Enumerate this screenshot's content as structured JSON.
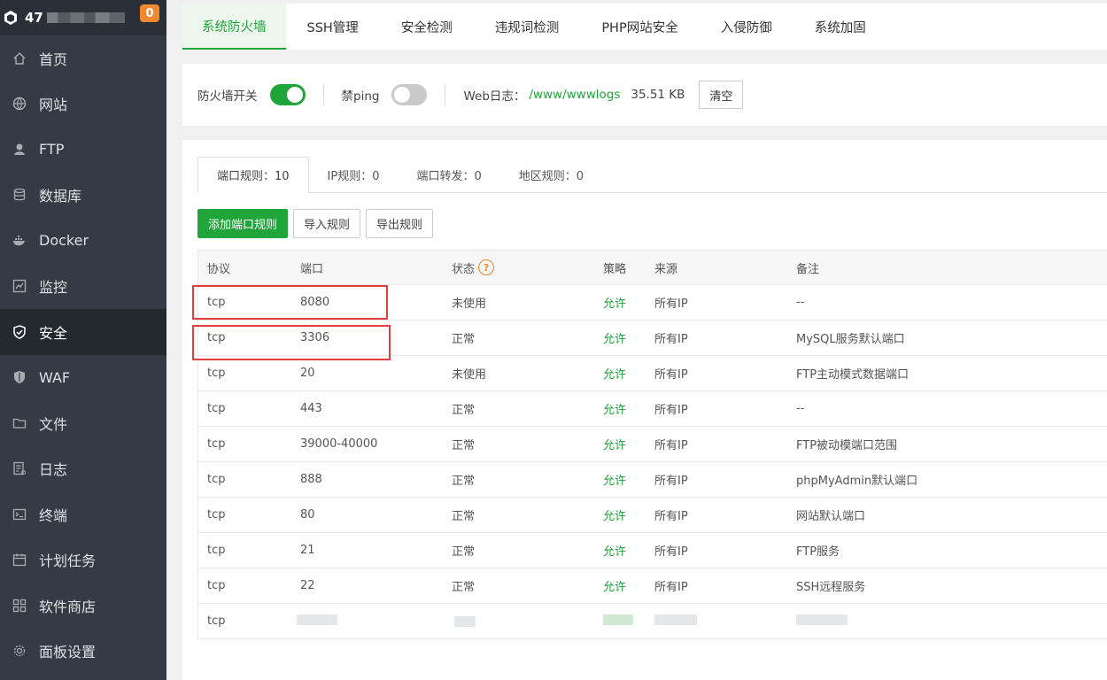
{
  "sidebar": {
    "server_prefix": "47",
    "badge": "0",
    "items": [
      {
        "label": "首页",
        "icon": "home-icon"
      },
      {
        "label": "网站",
        "icon": "globe-icon"
      },
      {
        "label": "FTP",
        "icon": "ftp-icon"
      },
      {
        "label": "数据库",
        "icon": "database-icon"
      },
      {
        "label": "Docker",
        "icon": "docker-icon"
      },
      {
        "label": "监控",
        "icon": "monitor-icon"
      },
      {
        "label": "安全",
        "icon": "shield-check-icon"
      },
      {
        "label": "WAF",
        "icon": "waf-shield-icon"
      },
      {
        "label": "文件",
        "icon": "folder-icon"
      },
      {
        "label": "日志",
        "icon": "log-icon"
      },
      {
        "label": "终端",
        "icon": "terminal-icon"
      },
      {
        "label": "计划任务",
        "icon": "calendar-icon"
      },
      {
        "label": "软件商店",
        "icon": "apps-grid-icon"
      },
      {
        "label": "面板设置",
        "icon": "gear-icon"
      }
    ],
    "active_index": 6
  },
  "tabs": [
    "系统防火墙",
    "SSH管理",
    "安全检测",
    "违规词检测",
    "PHP网站安全",
    "入侵防御",
    "系统加固"
  ],
  "firewall": {
    "switch_label": "防火墙开关",
    "switch_on": true,
    "ping_label": "禁ping",
    "ping_on": false,
    "log_label": "Web日志：",
    "log_path": "/www/wwwlogs",
    "log_size": "35.51 KB",
    "clear_label": "清空"
  },
  "subtabs": [
    {
      "label": "端口规则：10"
    },
    {
      "label": "IP规则：0"
    },
    {
      "label": "端口转发：0"
    },
    {
      "label": "地区规则：0"
    }
  ],
  "buttons": {
    "add": "添加端口规则",
    "import": "导入规则",
    "export": "导出规则"
  },
  "table": {
    "headers": [
      "协议",
      "端口",
      "状态",
      "策略",
      "来源",
      "备注"
    ],
    "status_help": "?",
    "rows": [
      {
        "protocol": "tcp",
        "port": "8080",
        "status": "未使用",
        "policy": "允许",
        "source": "所有IP",
        "note": "--"
      },
      {
        "protocol": "tcp",
        "port": "3306",
        "status": "正常",
        "policy": "允许",
        "source": "所有IP",
        "note": "MySQL服务默认端口"
      },
      {
        "protocol": "tcp",
        "port": "20",
        "status": "未使用",
        "policy": "允许",
        "source": "所有IP",
        "note": "FTP主动模式数据端口"
      },
      {
        "protocol": "tcp",
        "port": "443",
        "status": "正常",
        "policy": "允许",
        "source": "所有IP",
        "note": "--"
      },
      {
        "protocol": "tcp",
        "port": "39000-40000",
        "status": "正常",
        "policy": "允许",
        "source": "所有IP",
        "note": "FTP被动模端口范围"
      },
      {
        "protocol": "tcp",
        "port": "888",
        "status": "正常",
        "policy": "允许",
        "source": "所有IP",
        "note": "phpMyAdmin默认端口"
      },
      {
        "protocol": "tcp",
        "port": "80",
        "status": "正常",
        "policy": "允许",
        "source": "所有IP",
        "note": "网站默认端口"
      },
      {
        "protocol": "tcp",
        "port": "21",
        "status": "正常",
        "policy": "允许",
        "source": "所有IP",
        "note": "FTP服务"
      },
      {
        "protocol": "tcp",
        "port": "22",
        "status": "正常",
        "policy": "允许",
        "source": "所有IP",
        "note": "SSH远程服务"
      }
    ],
    "blurred_row": {
      "protocol": "tcp"
    }
  },
  "colors": {
    "accent": "#20a53a",
    "sidebar_bg": "#353b44",
    "badge": "#f0892f",
    "highlight": "#e43d3d"
  }
}
